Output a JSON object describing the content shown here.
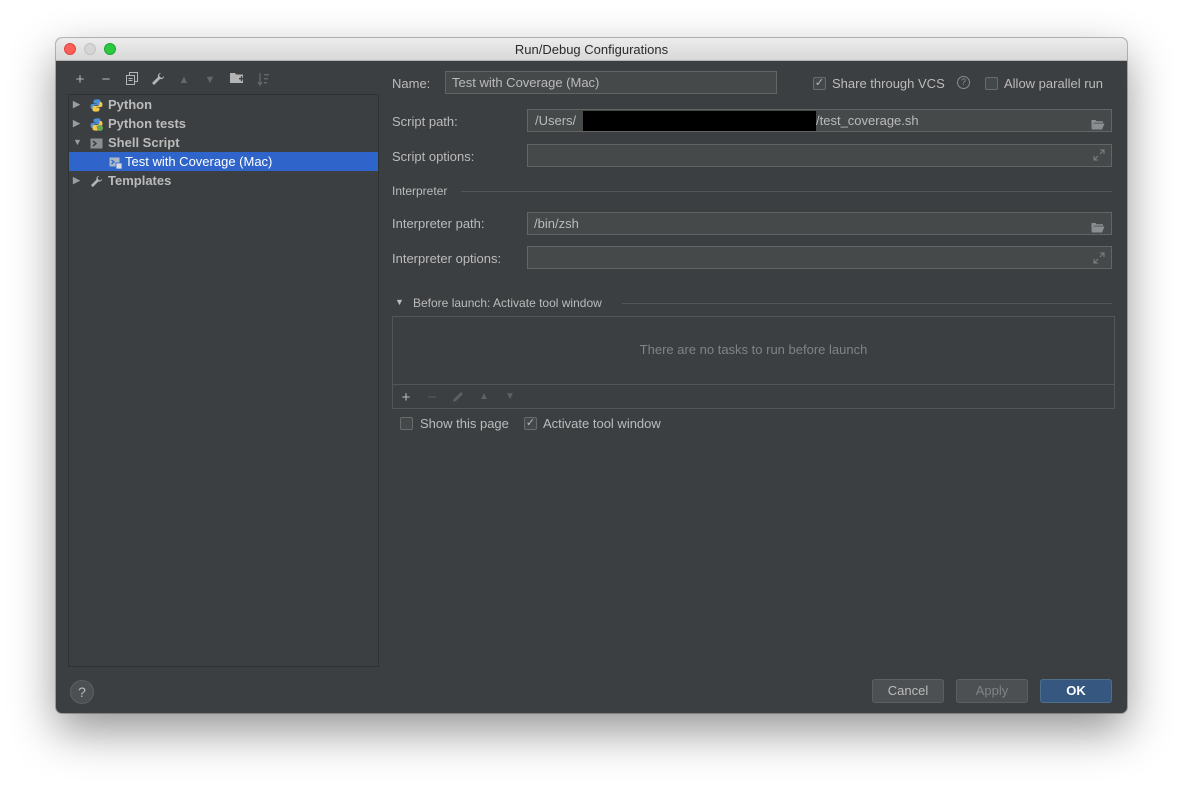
{
  "window": {
    "title": "Run/Debug Configurations"
  },
  "tree": {
    "items": [
      {
        "label": "Python",
        "icon": "python-icon",
        "expanded": false
      },
      {
        "label": "Python tests",
        "icon": "python-tests-icon",
        "expanded": false
      },
      {
        "label": "Shell Script",
        "icon": "shell-script-icon",
        "expanded": true
      },
      {
        "label": "Test with Coverage (Mac)",
        "icon": "shell-config-icon",
        "selected": true
      },
      {
        "label": "Templates",
        "icon": "wrench-icon",
        "expanded": false
      }
    ]
  },
  "form": {
    "name_label": "Name:",
    "name_value": "Test with Coverage (Mac)",
    "share_vcs_label": "Share through VCS",
    "share_vcs_checked": true,
    "allow_parallel_label": "Allow parallel run",
    "allow_parallel_checked": false,
    "script_path_label": "Script path:",
    "script_path_prefix": "/Users/",
    "script_path_suffix": "/test_coverage.sh",
    "script_options_label": "Script options:",
    "script_options_value": "",
    "interpreter_section": "Interpreter",
    "interpreter_path_label": "Interpreter path:",
    "interpreter_path_value": "/bin/zsh",
    "interpreter_options_label": "Interpreter options:",
    "interpreter_options_value": ""
  },
  "before_launch": {
    "title": "Before launch: Activate tool window",
    "empty_text": "There are no tasks to run before launch",
    "show_page_label": "Show this page",
    "show_page_checked": false,
    "activate_label": "Activate tool window",
    "activate_checked": true
  },
  "buttons": {
    "help": "?",
    "cancel": "Cancel",
    "apply": "Apply",
    "ok": "OK"
  },
  "colors": {
    "background": "#3c3f41",
    "selection": "#2f65ca",
    "ok_button": "#365880",
    "field": "#45494a"
  }
}
